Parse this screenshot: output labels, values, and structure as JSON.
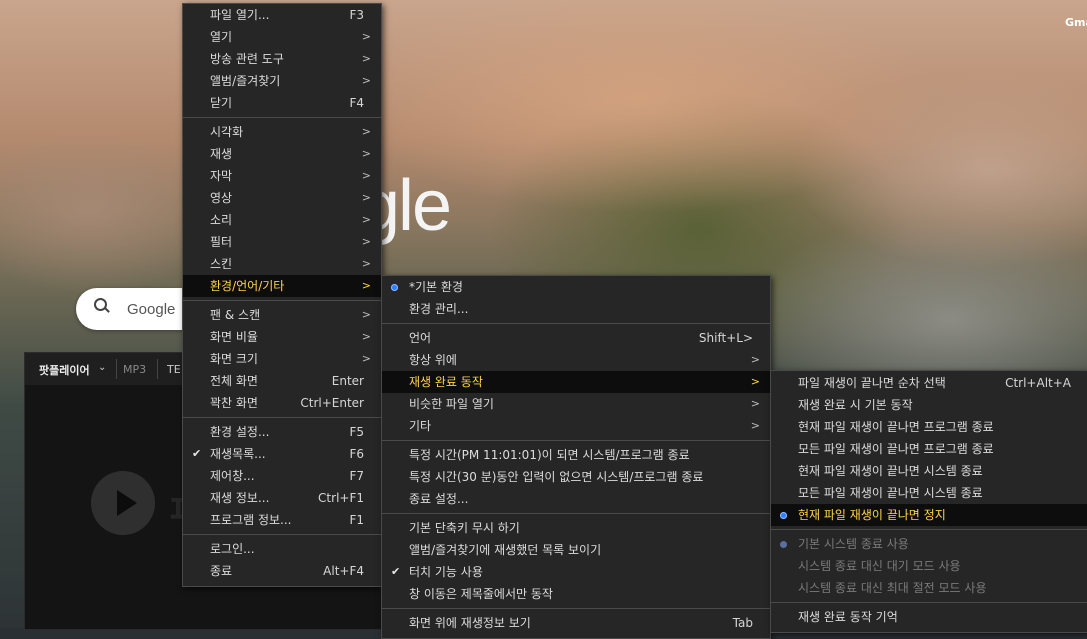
{
  "background": {
    "gmail_link": "Gmai",
    "google_logo": "gle",
    "search_placeholder": "Google"
  },
  "player": {
    "name": "팟플레이어",
    "chevron": "⌄",
    "format": "MP3",
    "tab": "TE"
  },
  "menu_main": [
    {
      "label": "파일 열기...",
      "shortcut": "F3"
    },
    {
      "label": "열기",
      "submenu": true
    },
    {
      "label": "방송 관련 도구",
      "submenu": true
    },
    {
      "label": "앨범/즐겨찾기",
      "submenu": true
    },
    {
      "label": "닫기",
      "shortcut": "F4"
    },
    {
      "separator": true
    },
    {
      "label": "시각화",
      "submenu": true
    },
    {
      "label": "재생",
      "submenu": true
    },
    {
      "label": "자막",
      "submenu": true
    },
    {
      "label": "영상",
      "submenu": true
    },
    {
      "label": "소리",
      "submenu": true
    },
    {
      "label": "필터",
      "submenu": true
    },
    {
      "label": "스킨",
      "submenu": true
    },
    {
      "label": "환경/언어/기타",
      "submenu": true,
      "highlighted": true
    },
    {
      "separator": true
    },
    {
      "label": "팬 & 스캔",
      "submenu": true
    },
    {
      "label": "화면 비율",
      "submenu": true
    },
    {
      "label": "화면 크기",
      "submenu": true
    },
    {
      "label": "전체 화면",
      "shortcut": "Enter"
    },
    {
      "label": "꽉찬 화면",
      "shortcut": "Ctrl+Enter"
    },
    {
      "separator": true
    },
    {
      "label": "환경 설정...",
      "shortcut": "F5"
    },
    {
      "label": "재생목록...",
      "shortcut": "F6",
      "checked": true
    },
    {
      "label": "제어창...",
      "shortcut": "F7"
    },
    {
      "label": "재생 정보...",
      "shortcut": "Ctrl+F1"
    },
    {
      "label": "프로그램 정보...",
      "shortcut": "F1"
    },
    {
      "separator": true
    },
    {
      "label": "로그인..."
    },
    {
      "label": "종료",
      "shortcut": "Alt+F4"
    }
  ],
  "menu_env": [
    {
      "label": "*기본 환경",
      "radio": true
    },
    {
      "label": "환경 관리..."
    },
    {
      "separator": true
    },
    {
      "label": "언어",
      "shortcut": "Shift+L>"
    },
    {
      "label": "항상 위에",
      "submenu": true
    },
    {
      "label": "재생 완료 동작",
      "submenu": true,
      "highlighted": true
    },
    {
      "label": "비슷한 파일 열기",
      "submenu": true
    },
    {
      "label": "기타",
      "submenu": true
    },
    {
      "separator": true
    },
    {
      "label": "특정 시간(PM 11:01:01)이 되면 시스템/프로그램 종료"
    },
    {
      "label": "특정 시간(30 분)동안 입력이 없으면 시스템/프로그램 종료"
    },
    {
      "label": "종료 설정..."
    },
    {
      "separator": true
    },
    {
      "label": "기본 단축키 무시 하기"
    },
    {
      "label": "앨범/즐겨찾기에 재생했던 목록 보이기"
    },
    {
      "label": "터치 기능 사용",
      "checked": true
    },
    {
      "label": "창 이동은 제목줄에서만 동작"
    },
    {
      "separator": true
    },
    {
      "label": "화면 위에 재생정보 보기",
      "shortcut": "Tab"
    }
  ],
  "menu_finish": [
    {
      "label": "파일 재생이 끝나면 순차 선택",
      "shortcut": "Ctrl+Alt+A"
    },
    {
      "label": "재생 완료 시 기본 동작"
    },
    {
      "label": "현재 파일 재생이 끝나면 프로그램 종료"
    },
    {
      "label": "모든 파일 재생이 끝나면 프로그램 종료"
    },
    {
      "label": "현재 파일 재생이 끝나면 시스템 종료"
    },
    {
      "label": "모든 파일 재생이 끝나면 시스템 종료"
    },
    {
      "label": "현재 파일 재생이 끝나면 정지",
      "radio": true,
      "highlighted": true
    },
    {
      "separator": true
    },
    {
      "label": "기본 시스템 종료 사용",
      "radio": true,
      "disabled": true
    },
    {
      "label": "시스템 종료 대신 대기 모드 사용",
      "disabled": true
    },
    {
      "label": "시스템 종료 대신 최대 절전 모드 사용",
      "disabled": true
    },
    {
      "separator": true
    },
    {
      "label": "재생 완료 동작 기억"
    }
  ],
  "glyphs": {
    "arrow": ">",
    "check": "✔"
  },
  "colors": {
    "menu_bg": "#262626",
    "highlight_text": "#ffd24a",
    "radio": "#2f7fff"
  }
}
